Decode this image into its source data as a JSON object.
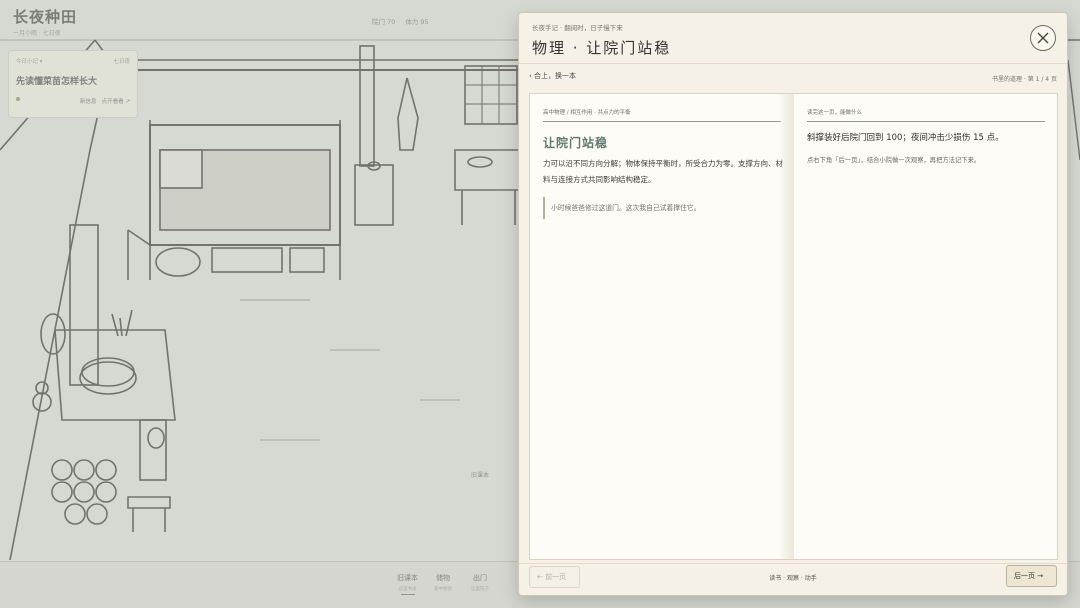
{
  "game": {
    "title": "长夜种田",
    "subtitle": "一月小雨 · 七日夜",
    "stats": [
      "院门 70",
      "体力 95"
    ],
    "task_card": {
      "label": "今日小记 ▾",
      "right_label": "七日夜",
      "task": "先读懂菜苗怎样长大",
      "action_left": "新信息",
      "action_right": "点开看看 ↗"
    },
    "side_fragment": "旧课本",
    "bottom_nav": [
      {
        "label": "旧课本",
        "sub": "这里书桌"
      },
      {
        "label": "储物",
        "sub": "家中物资"
      },
      {
        "label": "出门",
        "sub": "这里院子"
      }
    ]
  },
  "modal": {
    "breadcrumb": "长夜手记 · 翻阅时，日子慢下来",
    "title": "物理 · 让院门站稳",
    "back_label": "‹ 合上，换一本",
    "page_indicator": "书里的道理 · 第 1 / 4 页",
    "left_page": {
      "header": "高中物理 / 相互作用 · 共点力的平衡",
      "title": "让院门站稳",
      "body": "力可以沿不同方向分解；物体保持平衡时，所受合力为零。支撑方向、材料与连接方式共同影响结构稳定。",
      "quote": "小时候爸爸修过这道门。这次我自己试着撑住它。"
    },
    "right_page": {
      "header": "读完这一页，能做什么",
      "main": "斜撑装好后院门回到 100；夜间冲击少损伤 15 点。",
      "hint": "点右下角「后一页」，结合小院做一次观察，再把方法记下来。"
    },
    "footer": {
      "prev_label": "← 前一页",
      "center": "读书 · 观察 · 动手",
      "next_label": "后一页 →"
    }
  },
  "icons": {
    "close": "close-icon"
  }
}
